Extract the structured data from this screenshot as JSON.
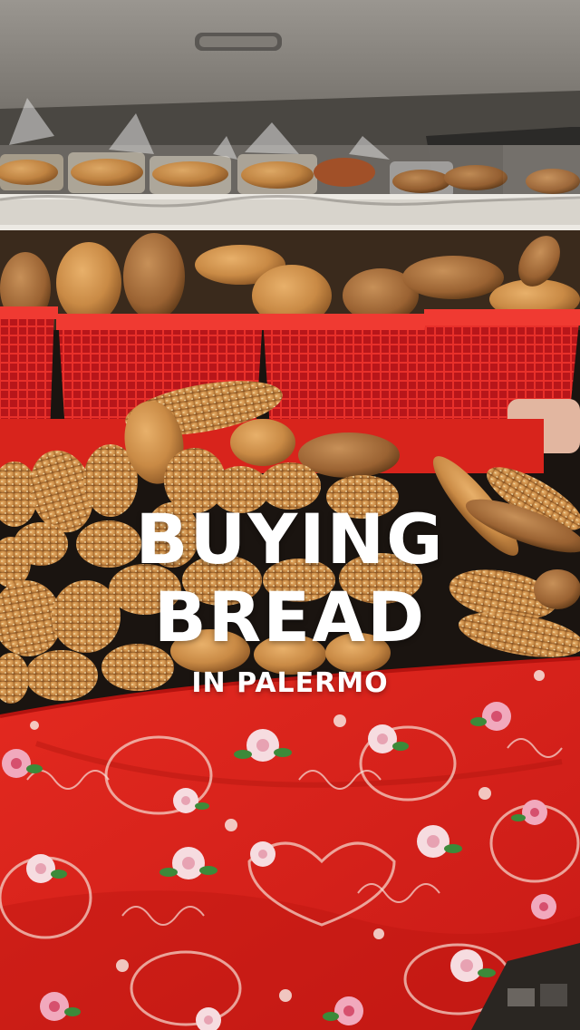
{
  "overlay": {
    "line1": "BUYING",
    "line2": "BREAD",
    "line3": "IN PALERMO"
  },
  "colors": {
    "text": "#ffffff",
    "tablecloth": "#e0241c",
    "basket": "#e8302a",
    "bread": "#c98a45"
  }
}
